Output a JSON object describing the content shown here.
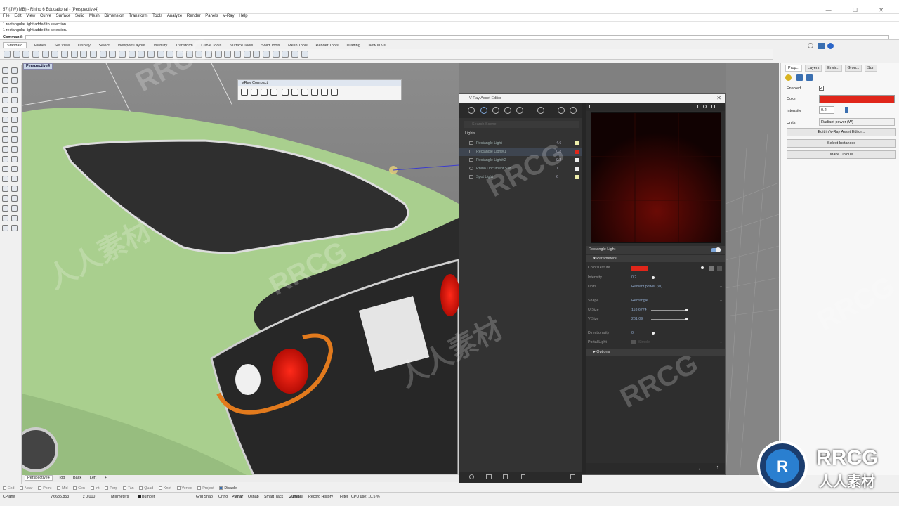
{
  "window": {
    "title": "57 (JW) MB) - Rhino 6 Educational - [Perspective4]",
    "controls": "— ☐ ✕"
  },
  "menu": [
    "File",
    "Edit",
    "View",
    "Curve",
    "Surface",
    "Solid",
    "Mesh",
    "Dimension",
    "Transform",
    "Tools",
    "Analyze",
    "Render",
    "Panels",
    "V-Ray",
    "Help"
  ],
  "command_history": [
    "1 rectangular light added to selection.",
    "1 rectangular light added to selection."
  ],
  "command_prompt": "Command:",
  "toolbar_tabs": [
    "Standard",
    "CPlanes",
    "Set View",
    "Display",
    "Select",
    "Viewport Layout",
    "Visibility",
    "Transform",
    "Curve Tools",
    "Surface Tools",
    "Solid Tools",
    "Mesh Tools",
    "Render Tools",
    "Drafting",
    "New in V6"
  ],
  "viewport": {
    "title": "Perspective4"
  },
  "vray_compact": {
    "title": "VRay Compact"
  },
  "asset_editor": {
    "title": "V-Ray Asset Editor",
    "search_placeholder": "Search Scene",
    "section": "Lights",
    "lights": [
      {
        "name": "Rectangle Light",
        "value": "4.6",
        "color": "#eeeeaa"
      },
      {
        "name": "Rectangle Light#1",
        "value": "0.2",
        "color": "#e0261a"
      },
      {
        "name": "Rectangle Light#2",
        "value": "0.2",
        "color": "#ffffff"
      },
      {
        "name": "Rhino Document Sun",
        "value": "1",
        "color": "#ffffff"
      },
      {
        "name": "Spot Light",
        "value": "6",
        "color": "#eeeeaa"
      }
    ],
    "selected_light": "Rectangle Light",
    "parameters_label": "Parameters",
    "options_label": "Options",
    "params": {
      "color_label": "Color/Texture",
      "color": "#e0261a",
      "intensity_label": "Intensity",
      "intensity": "0.2",
      "units_label": "Units",
      "units": "Radiant power (W)",
      "shape_label": "Shape",
      "shape": "Rectangle",
      "usize_label": "U Size",
      "usize": "118.6774",
      "vsize_label": "V Size",
      "vsize": "261.09",
      "directionality_label": "Directionality",
      "directionality": "0",
      "portal_label": "Portal Light",
      "portal_value": "Simple"
    }
  },
  "properties": {
    "tabs": [
      "Prop...",
      "Layers",
      "Envir...",
      "Grou...",
      "Sun"
    ],
    "enabled_label": "Enabled",
    "color_label": "Color",
    "color": "#e0261a",
    "intensity_label": "Intensity",
    "intensity": "0.2",
    "units_label": "Units",
    "units": "Radiant power (W)",
    "btn_edit": "Edit in V-Ray Asset Editor...",
    "btn_select": "Select Instances",
    "btn_unique": "Make Unique"
  },
  "viewport_tabs": [
    "Perspective4",
    "Top",
    "Back",
    "Left",
    "+"
  ],
  "osnaps": [
    "End",
    "Near",
    "Point",
    "Mid",
    "Cen",
    "Int",
    "Perp",
    "Tan",
    "Quad",
    "Knot",
    "Vertex",
    "Project",
    "Disable"
  ],
  "status": {
    "cplane": "CPlane",
    "y": "y 6685.853",
    "z": "z 0.000",
    "units": "Millimeters",
    "layer": "Bumper",
    "modes": [
      "Grid Snap",
      "Ortho",
      "Planar",
      "Osnap",
      "SmartTrack",
      "Gumball",
      "Record History",
      "Filter"
    ],
    "cpu": "CPU use: 10.5 %"
  },
  "watermark": {
    "text": "RRCG",
    "cn": "人人素材"
  },
  "colors": {
    "car_body": "#a9cf8e",
    "light_red": "#e0261a",
    "accent_blue": "#7da6d9"
  }
}
